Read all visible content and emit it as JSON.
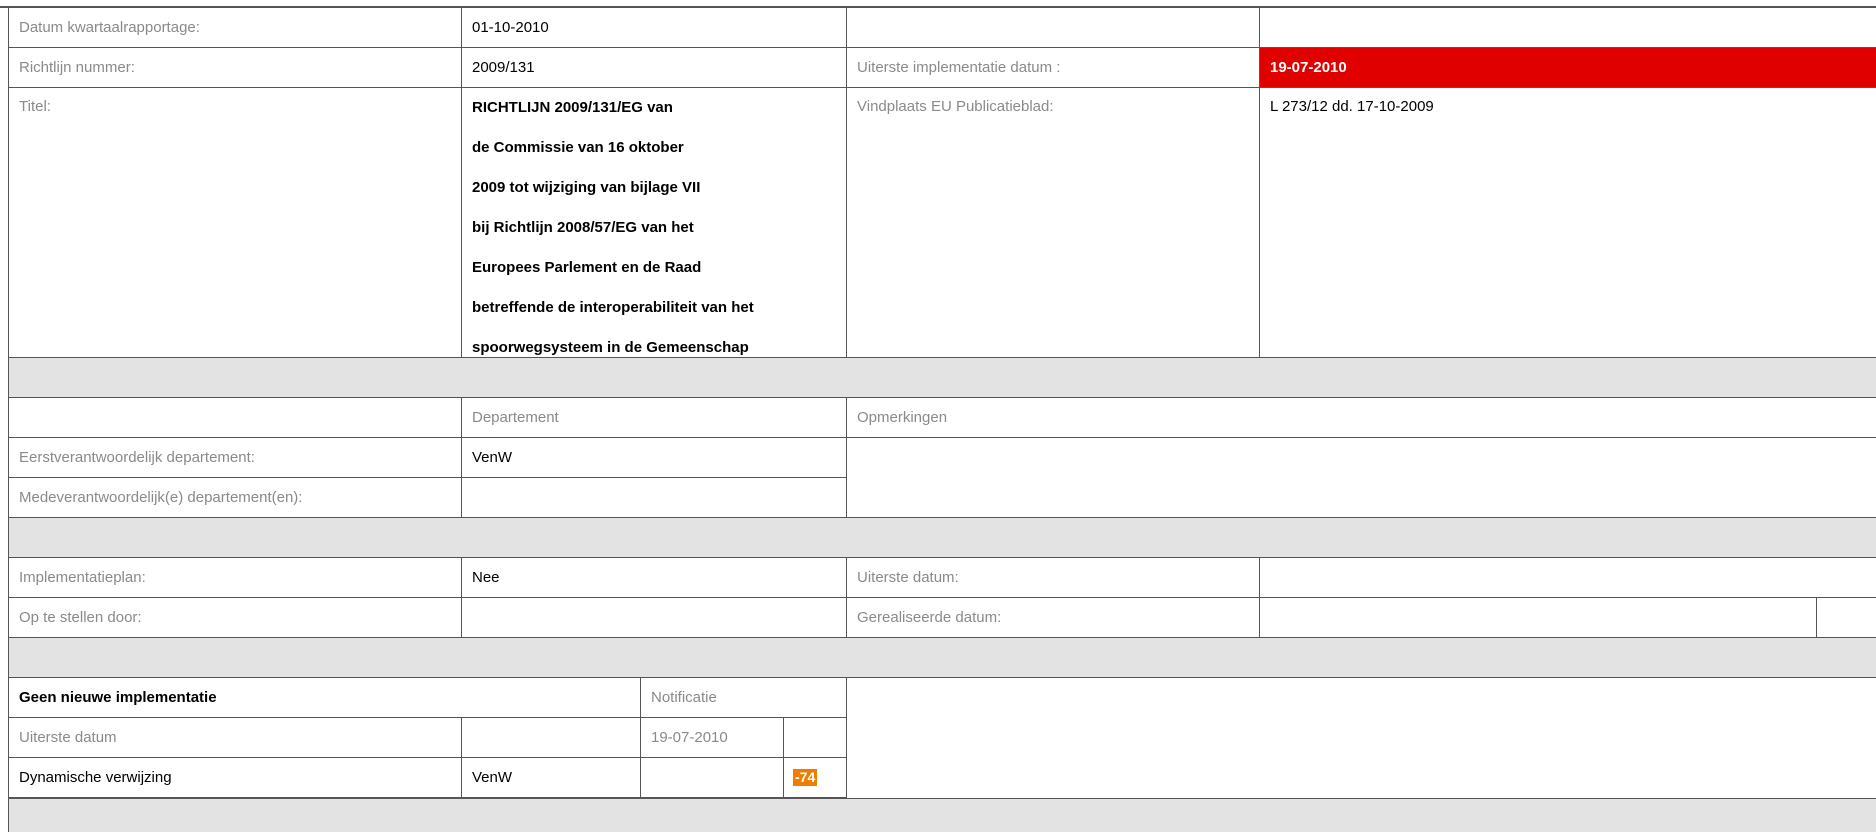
{
  "header": {
    "datum_label": "Datum kwartaalrapportage:",
    "datum_value": "01-10-2010",
    "richtlijn_label": "Richtlijn nummer:",
    "richtlijn_value": "2009/131",
    "uiterste_impl_label": "Uiterste implementatie datum :",
    "uiterste_impl_value": "19-07-2010",
    "titel_label": "Titel:",
    "titel_lines": [
      "RICHTLIJN 2009/131/EG van",
      "de Commissie van 16 oktober",
      "2009 tot wijziging van bijlage VII",
      "bij Richtlijn 2008/57/EG van het",
      "Europees Parlement en de Raad",
      "betreffende de interoperabiliteit van het",
      "spoorwegsysteem in de Gemeenschap"
    ],
    "vindplaats_label": "Vindplaats EU Publicatieblad:",
    "vindplaats_value": "L 273/12 dd. 17-10-2009"
  },
  "departments": {
    "col_departement": "Departement",
    "col_opmerkingen": "Opmerkingen",
    "eerst_label": "Eerstverantwoordelijk departement:",
    "eerst_value": "VenW",
    "mede_label": "Medeverantwoordelijk(e) departement(en):",
    "mede_value": ""
  },
  "plan": {
    "impl_label": "Implementatieplan:",
    "impl_value": "Nee",
    "uiterste_label": "Uiterste datum:",
    "uiterste_value": "",
    "op_label": "Op te stellen door:",
    "op_value": "",
    "gerealiseerd_label": "Gerealiseerde datum:",
    "gerealiseerd_value": ""
  },
  "notification": {
    "heading": "Geen nieuwe implementatie",
    "notificatie_label": "Notificatie",
    "uiterste_label": "Uiterste datum",
    "uiterste_value": "",
    "notificatie_date": "19-07-2010",
    "dyn_label": "Dynamische verwijzing",
    "dyn_value": "VenW",
    "badge": "-74"
  },
  "colors": {
    "red_highlight": "#e10000",
    "orange_badge": "#f07d00",
    "gray_row": "#e3e3e3",
    "label_text": "#8a8a8a"
  }
}
